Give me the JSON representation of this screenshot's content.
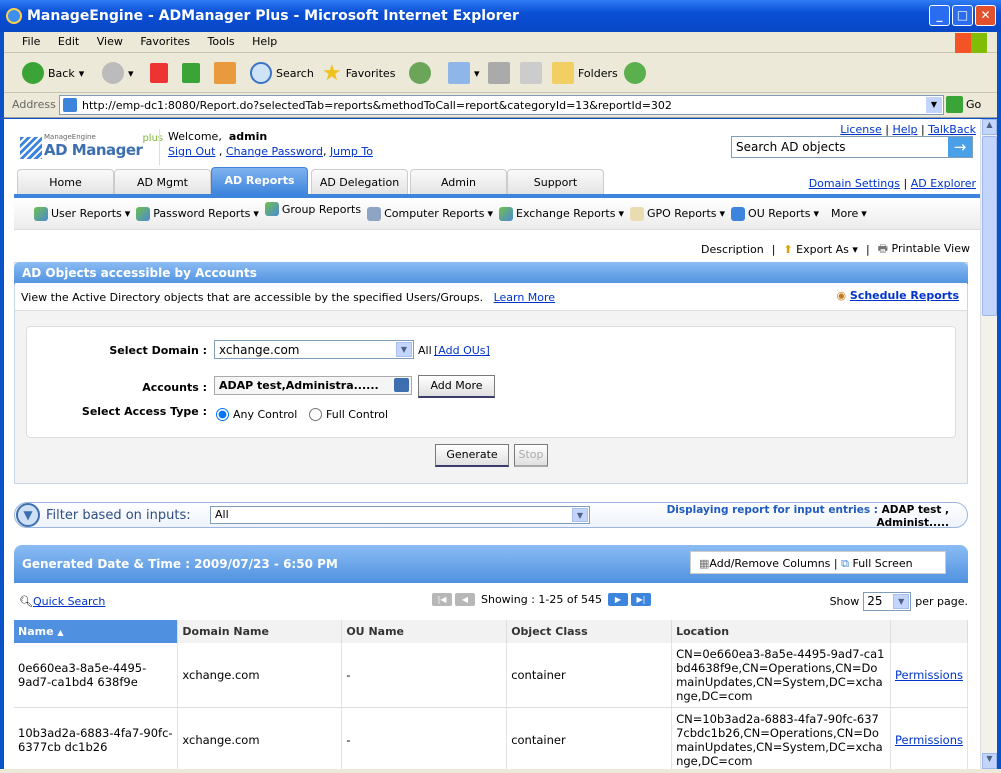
{
  "window": {
    "title": "ManageEngine - ADManager Plus - Microsoft Internet Explorer"
  },
  "menu": [
    "File",
    "Edit",
    "View",
    "Favorites",
    "Tools",
    "Help"
  ],
  "toolbar": {
    "back": "Back",
    "search": "Search",
    "favorites": "Favorites",
    "folders": "Folders"
  },
  "address": {
    "label": "Address",
    "url": "http://emp-dc1:8080/Report.do?selectedTab=reports&methodToCall=report&categoryId=13&reportId=302",
    "go": "Go"
  },
  "header": {
    "logo_brand": "ManageEngine",
    "logo_product": "AD Manager",
    "logo_plus": "plus",
    "welcome": "Welcome,",
    "user": "admin",
    "sign_out": "Sign Out",
    "change_password": "Change Password",
    "jump_to": "Jump To",
    "top_links": [
      "License",
      "Help",
      "TalkBack"
    ],
    "search_placeholder": "Search AD objects",
    "domain_settings": "Domain Settings",
    "ad_explorer": "AD Explorer"
  },
  "tabs": [
    "Home",
    "AD Mgmt",
    "AD Reports",
    "AD Delegation",
    "Admin",
    "Support"
  ],
  "subnav": [
    "User Reports",
    "Password Reports",
    "Group Reports",
    "Computer Reports",
    "Exchange Reports",
    "GPO Reports",
    "OU Reports",
    "More"
  ],
  "actions": {
    "description": "Description",
    "export": "Export As",
    "printable": "Printable View"
  },
  "report": {
    "title": "AD Objects accessible by Accounts",
    "desc": "View the Active Directory objects that are accessible by the specified Users/Groups.",
    "learn_more": "Learn More",
    "schedule": "Schedule Reports"
  },
  "form": {
    "domain_label": "Select Domain :",
    "domain_value": "xchange.com",
    "all": "All",
    "add_ous": "[Add OUs]",
    "accounts_label": "Accounts :",
    "accounts_value": "ADAP test,Administra......",
    "add_more": "Add More",
    "access_label": "Select Access Type :",
    "access_options": [
      "Any Control",
      "Full Control"
    ],
    "generate": "Generate",
    "stop": "Stop"
  },
  "filter": {
    "label": "Filter based on inputs:",
    "value": "All",
    "display_label": "Displaying report for input entries :",
    "display_value1": "ADAP test ,",
    "display_value2": "Administ....."
  },
  "results": {
    "generated": "Generated Date & Time : 2009/07/23 - 6:50 PM",
    "add_remove": "Add/Remove Columns",
    "full_screen": "Full Screen",
    "quick_search": "Quick Search",
    "showing": "Showing : 1-25 of 545",
    "show": "Show",
    "per_page_value": "25",
    "per_page": "per page.",
    "columns": [
      "Name",
      "Domain Name",
      "OU Name",
      "Object Class",
      "Location",
      ""
    ],
    "rows": [
      {
        "name": "0e660ea3-8a5e-4495-9ad7-ca1bd4 638f9e",
        "domain": "xchange.com",
        "ou": "-",
        "class": "container",
        "location": "CN=0e660ea3-8a5e-4495-9ad7-ca1bd4638f9e,CN=Operations,CN=DomainUpdates,CN=System,DC=xchange,DC=com",
        "action": "Permissions"
      },
      {
        "name": "10b3ad2a-6883-4fa7-90fc-6377cb dc1b26",
        "domain": "xchange.com",
        "ou": "-",
        "class": "container",
        "location": "CN=10b3ad2a-6883-4fa7-90fc-6377cbdc1b26,CN=Operations,CN=DomainUpdates,CN=System,DC=xchange,DC=com",
        "action": "Permissions"
      }
    ]
  }
}
